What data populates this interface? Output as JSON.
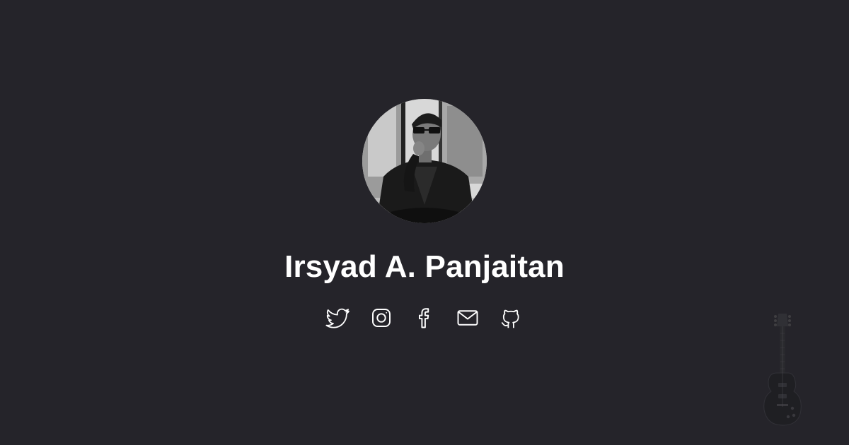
{
  "profile": {
    "name": "Irsyad A. Panjaitan",
    "avatar_icon": "portrait-photo",
    "avatar_alt": "Irsyad A. Panjaitan"
  },
  "social": [
    {
      "icon": "twitter-icon",
      "label": "Twitter"
    },
    {
      "icon": "instagram-icon",
      "label": "Instagram"
    },
    {
      "icon": "facebook-icon",
      "label": "Facebook"
    },
    {
      "icon": "mail-icon",
      "label": "Email"
    },
    {
      "icon": "github-icon",
      "label": "GitHub"
    }
  ],
  "decoration": {
    "icon": "guitar-icon"
  },
  "colors": {
    "background": "#25242a",
    "text": "#ffffff"
  }
}
